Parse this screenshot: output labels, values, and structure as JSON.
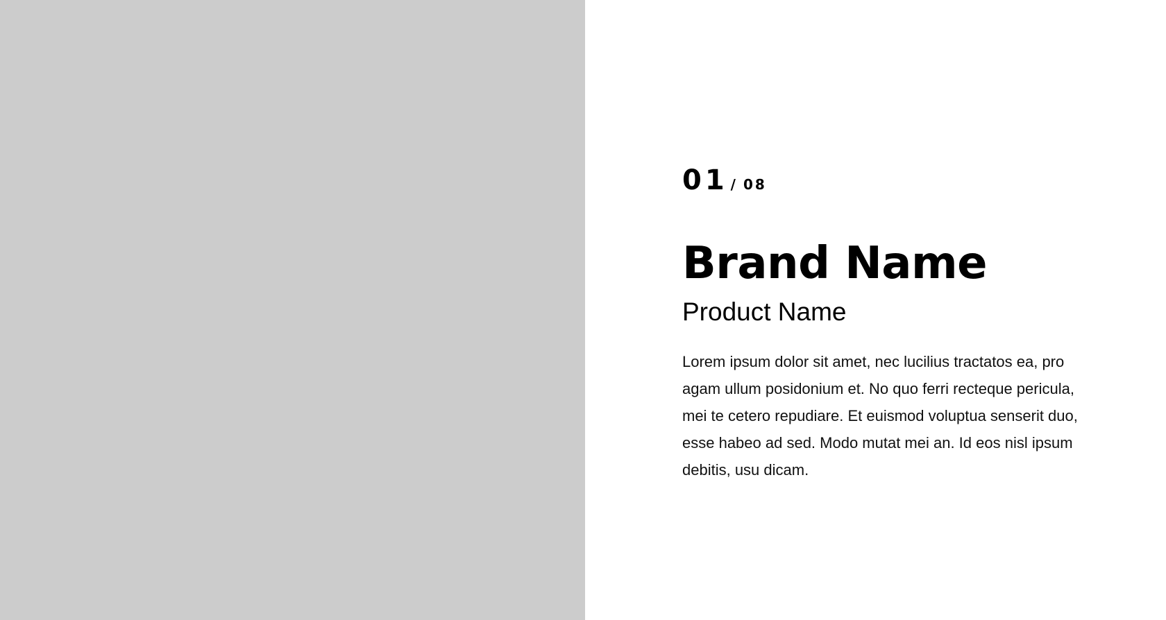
{
  "slide": {
    "counter": {
      "current": "01",
      "separator": "/",
      "total": "08"
    },
    "brand_name": "Brand Name",
    "product_name": "Product Name",
    "description": "Lorem ipsum dolor sit amet, nec lucilius tractatos ea, pro agam ullum posidonium et. No quo ferri recteque pericula, mei te cetero repudiare. Et euismod voluptua senserit duo, esse habeo ad sed. Modo mutat mei an. Id eos nisl ipsum debitis, usu dicam."
  },
  "colors": {
    "placeholder": "#cccccc",
    "background": "#ffffff",
    "text": "#000000"
  }
}
